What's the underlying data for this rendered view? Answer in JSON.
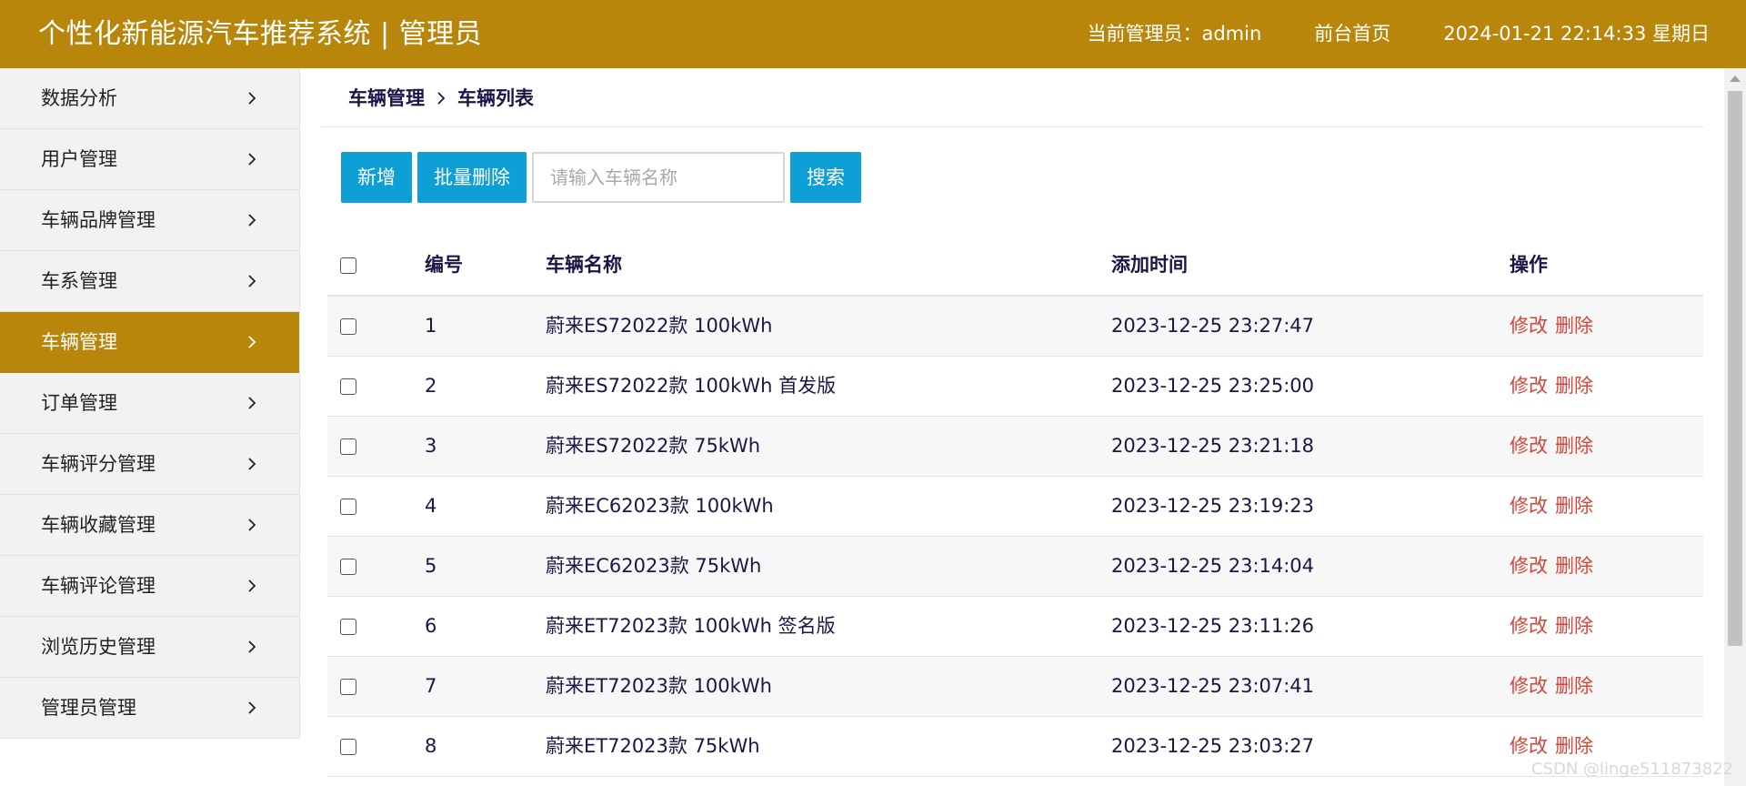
{
  "header": {
    "title": "个性化新能源汽车推荐系统 | 管理员",
    "admin_label": "当前管理员：admin",
    "home_link": "前台首页",
    "datetime": "2024-01-21  22:14:33  星期日",
    "bg_color": "#b8860b"
  },
  "sidebar": {
    "items": [
      {
        "label": "数据分析",
        "icon": "chevron-right-icon"
      },
      {
        "label": "用户管理",
        "icon": "chevron-right-icon"
      },
      {
        "label": "车辆品牌管理",
        "icon": "chevron-right-icon"
      },
      {
        "label": "车系管理",
        "icon": "chevron-right-icon"
      },
      {
        "label": "车辆管理",
        "icon": "chevron-right-icon",
        "active": true
      },
      {
        "label": "订单管理",
        "icon": "chevron-right-icon"
      },
      {
        "label": "车辆评分管理",
        "icon": "chevron-right-icon"
      },
      {
        "label": "车辆收藏管理",
        "icon": "chevron-right-icon"
      },
      {
        "label": "车辆评论管理",
        "icon": "chevron-right-icon"
      },
      {
        "label": "浏览历史管理",
        "icon": "chevron-right-icon"
      },
      {
        "label": "管理员管理",
        "icon": "chevron-right-icon"
      }
    ],
    "active_color": "#b8860b"
  },
  "breadcrumb": {
    "parent": "车辆管理",
    "current": "车辆列表"
  },
  "toolbar": {
    "add_label": "新增",
    "batch_delete_label": "批量删除",
    "search_placeholder": "请输入车辆名称",
    "search_value": "",
    "search_label": "搜索",
    "button_color": "#0e9fd6"
  },
  "table": {
    "columns": {
      "id": "编号",
      "name": "车辆名称",
      "time": "添加时间",
      "ops": "操作"
    },
    "rows": [
      {
        "id": "1",
        "name": "蔚来ES72022款 100kWh",
        "time": "2023-12-25 23:27:47",
        "edit": "修改",
        "delete": "删除"
      },
      {
        "id": "2",
        "name": "蔚来ES72022款 100kWh 首发版",
        "time": "2023-12-25 23:25:00",
        "edit": "修改",
        "delete": "删除"
      },
      {
        "id": "3",
        "name": "蔚来ES72022款 75kWh",
        "time": "2023-12-25 23:21:18",
        "edit": "修改",
        "delete": "删除"
      },
      {
        "id": "4",
        "name": "蔚来EC62023款 100kWh",
        "time": "2023-12-25 23:19:23",
        "edit": "修改",
        "delete": "删除"
      },
      {
        "id": "5",
        "name": "蔚来EC62023款 75kWh",
        "time": "2023-12-25 23:14:04",
        "edit": "修改",
        "delete": "删除"
      },
      {
        "id": "6",
        "name": "蔚来ET72023款 100kWh 签名版",
        "time": "2023-12-25 23:11:26",
        "edit": "修改",
        "delete": "删除"
      },
      {
        "id": "7",
        "name": "蔚来ET72023款 100kWh",
        "time": "2023-12-25 23:07:41",
        "edit": "修改",
        "delete": "删除"
      },
      {
        "id": "8",
        "name": "蔚来ET72023款 75kWh",
        "time": "2023-12-25 23:03:27",
        "edit": "修改",
        "delete": "删除"
      }
    ],
    "op_color": "#d6453a"
  },
  "watermark": "CSDN @linge511873822"
}
